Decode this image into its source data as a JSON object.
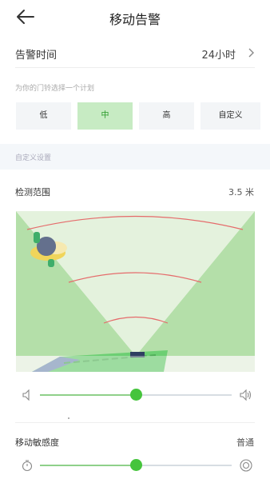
{
  "header": {
    "title": "移动告警",
    "back_icon": "arrow-left-icon"
  },
  "alarm_time": {
    "label": "告警时间",
    "value": "24小时",
    "chevron_icon": "chevron-right-icon"
  },
  "plan": {
    "hint": "为你的门铃选择一个计划",
    "options": [
      "低",
      "中",
      "高",
      "自定义"
    ],
    "selected": "中"
  },
  "custom_section": {
    "title": "自定义设置"
  },
  "detection": {
    "label": "检测范围",
    "value": "3.5 米",
    "slider_fraction": 0.5,
    "left_icon": "volume-low-icon",
    "right_icon": "volume-high-icon"
  },
  "sensitivity": {
    "label": "移动敏感度",
    "value": "普通",
    "slider_fraction": 0.5,
    "left_icon": "slow-icon",
    "right_icon": "fast-icon"
  },
  "colors": {
    "accent": "#45c43c",
    "selected_bg": "#c7ebc3",
    "arc": "#e56b6b",
    "field_green": "#b4dfa9"
  }
}
